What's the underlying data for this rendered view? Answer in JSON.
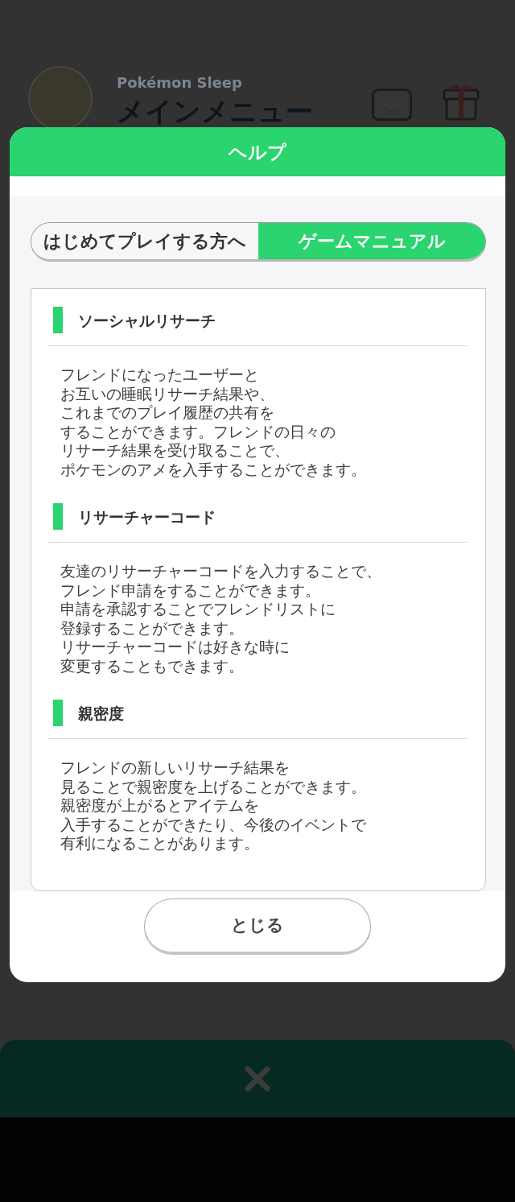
{
  "background": {
    "app_name": "Pokémon Sleep",
    "screen_title": "メインメニュー"
  },
  "dialog": {
    "title": "ヘルプ",
    "tabs": [
      {
        "label": "はじめてプレイする方へ",
        "selected": false
      },
      {
        "label": "ゲームマニュアル",
        "selected": true
      }
    ],
    "sections": [
      {
        "heading": "ソーシャルリサーチ",
        "lines": [
          "フレンドになったユーザーと",
          "お互いの睡眠リサーチ結果や、",
          "これまでのプレイ履歴の共有を",
          "することができます。フレンドの日々の",
          "リサーチ結果を受け取ることで、",
          "ポケモンのアメを入手することができます。"
        ]
      },
      {
        "heading": "リサーチャーコード",
        "lines": [
          "友達のリサーチャーコードを入力することで、",
          "フレンド申請をすることができます。",
          "申請を承認することでフレンドリストに",
          "登録することができます。",
          "リサーチャーコードは好きな時に",
          "変更することもできます。"
        ]
      },
      {
        "heading": "親密度",
        "lines": [
          "フレンドの新しいリサーチ結果を",
          "見ることで親密度を上げることができます。",
          "親密度が上がるとアイテムを",
          "入手することができたり、今後のイベントで",
          "有利になることがあります。"
        ]
      }
    ],
    "close_button": "とじる"
  }
}
